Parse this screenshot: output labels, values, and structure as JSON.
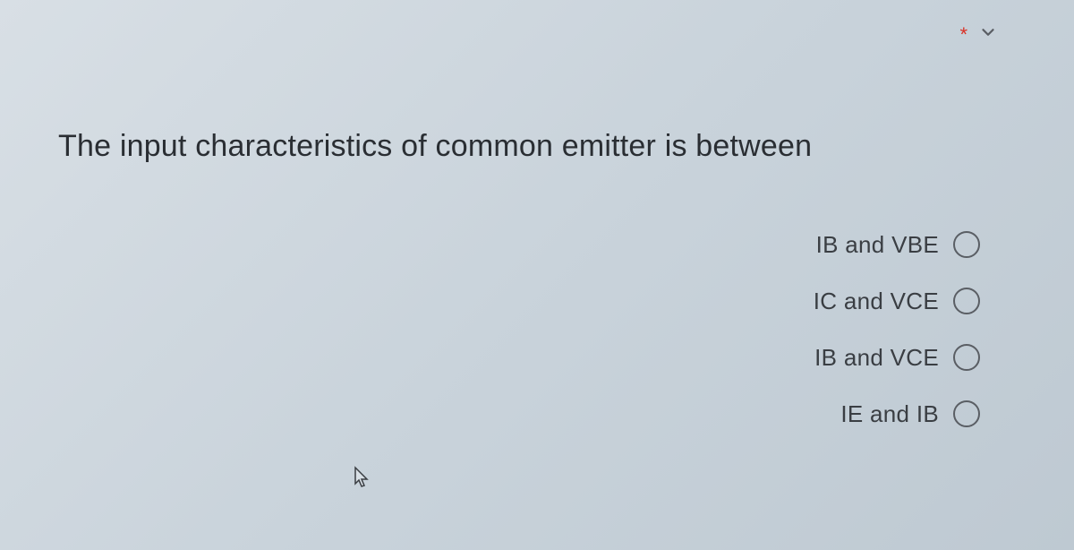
{
  "header": {
    "required_marker": "*"
  },
  "question": {
    "text": "The input characteristics of common emitter is between"
  },
  "options": [
    {
      "label": "IB and VBE"
    },
    {
      "label": "IC and VCE"
    },
    {
      "label": "IB and VCE"
    },
    {
      "label": "IE and IB"
    }
  ]
}
